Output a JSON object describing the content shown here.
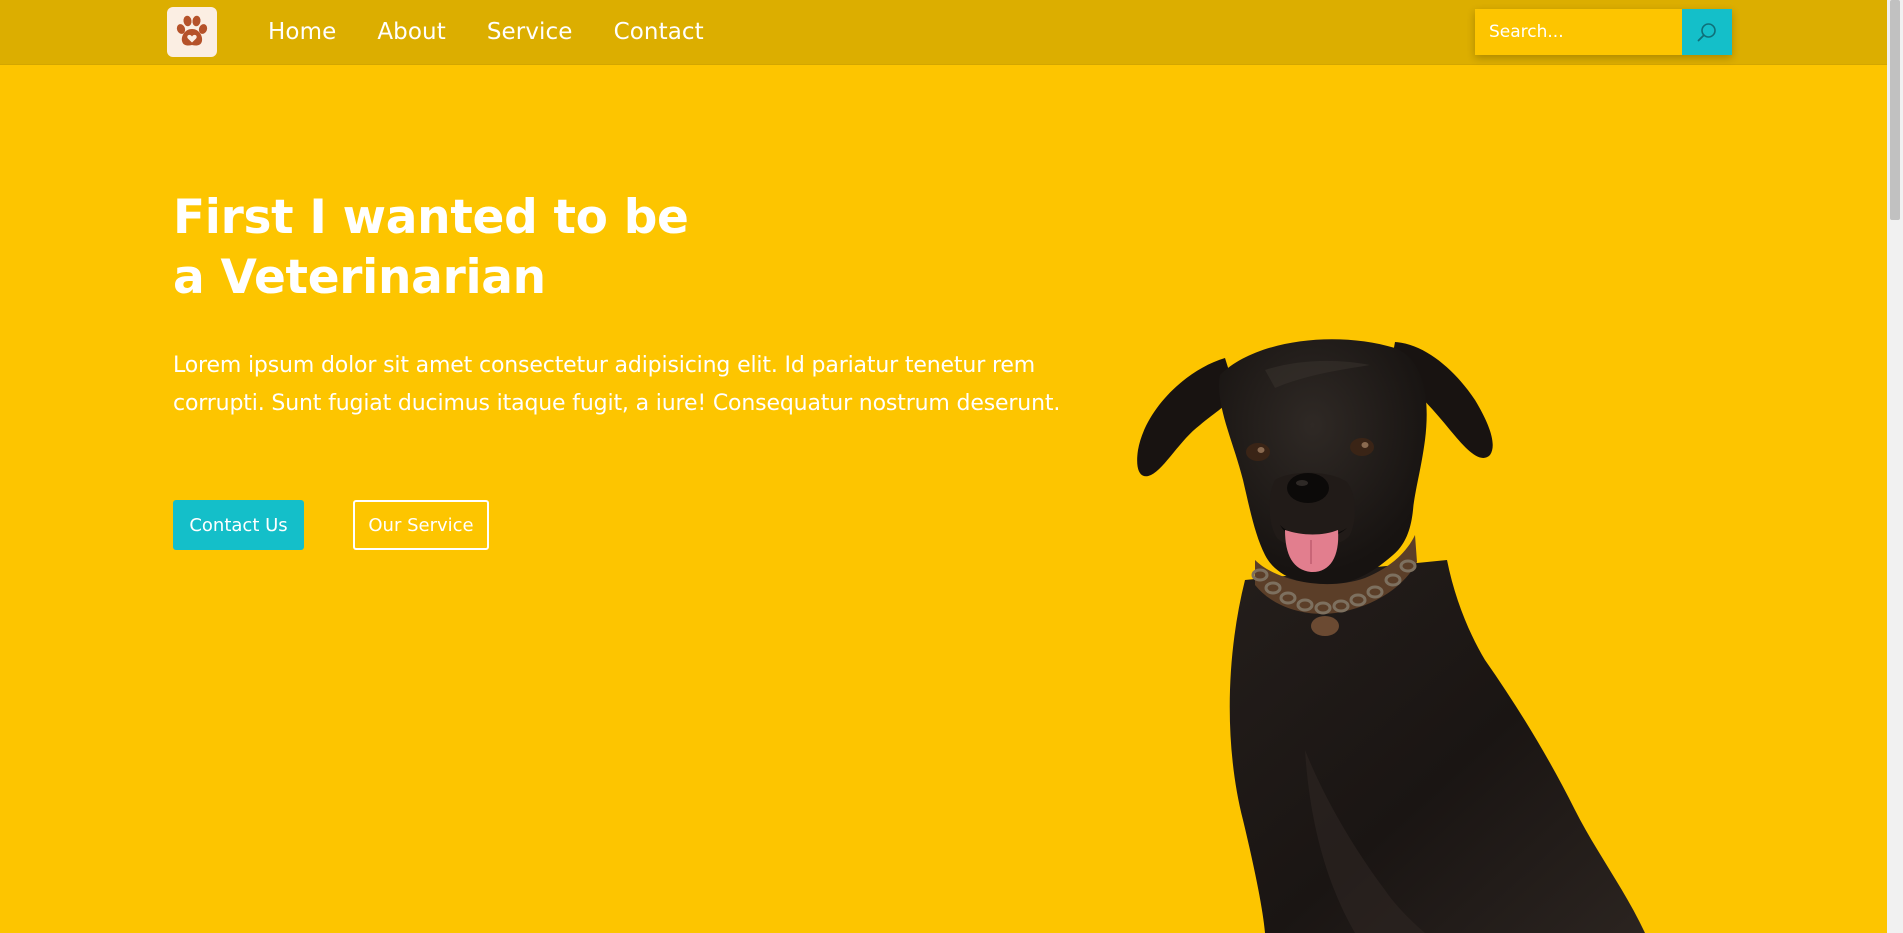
{
  "nav": {
    "logo_icon": "paw-heart-icon",
    "links": [
      {
        "label": "Home"
      },
      {
        "label": "About"
      },
      {
        "label": "Service"
      },
      {
        "label": "Contact"
      }
    ],
    "search": {
      "placeholder": "Search...",
      "button_icon": "search-icon"
    }
  },
  "hero": {
    "title_line1": "First I wanted to be",
    "title_line2": "a Veterinarian",
    "description": "Lorem ipsum dolor sit amet consectetur adipisicing elit. Id pariatur tenetur rem corrupti. Sunt fugiat ducimus itaque fugit, a iure! Consequatur nostrum deserunt.",
    "primary_button": "Contact Us",
    "secondary_button": "Our Service",
    "image": "black-labrador-dog"
  },
  "colors": {
    "background": "#fdc500",
    "navbar": "#dcae00",
    "accent": "#14bfc9",
    "text": "#ffffff",
    "logo_background": "#fbeee3",
    "logo_icon": "#b5522a"
  }
}
